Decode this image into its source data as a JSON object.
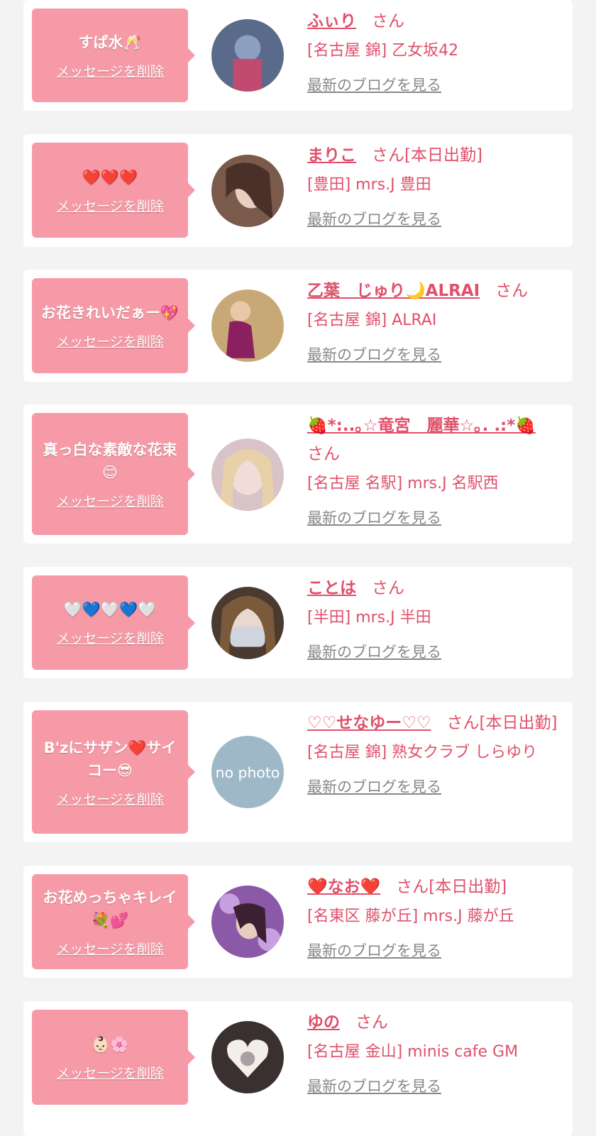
{
  "items": [
    {
      "message": "すぱ水🥂",
      "delete_label": "メッセージを削除",
      "name": "ふぃり",
      "suffix": "さん",
      "shop": "[名古屋 錦] 乙女坂42",
      "blog_label": "最新のブログを見る",
      "avatar_color": "#5a6a8a"
    },
    {
      "message": "❤️❤️❤️",
      "delete_label": "メッセージを削除",
      "name": "まりこ",
      "suffix": "さん[本日出勤]",
      "shop": "[豊田] mrs.J 豊田",
      "blog_label": "最新のブログを見る",
      "avatar_color": "#7a5a4a"
    },
    {
      "message": "お花きれいだぁー💖",
      "delete_label": "メッセージを削除",
      "name": "乙葉　じゅり🌙ALRAI",
      "suffix": "さん",
      "shop": "[名古屋 錦] ALRAI",
      "blog_label": "最新のブログを見る",
      "avatar_color": "#c9a878"
    },
    {
      "message": "真っ白な素敵な花束😊",
      "delete_label": "メッセージを削除",
      "name": "🍓*:..｡☆竜宮　麗華☆｡. .:*🍓",
      "suffix": "さん",
      "shop": "[名古屋 名駅] mrs.J 名駅西",
      "blog_label": "最新のブログを見る",
      "avatar_color": "#d8c4c8"
    },
    {
      "message": "🤍💙🤍💙🤍",
      "delete_label": "メッセージを削除",
      "name": "ことは",
      "suffix": "さん",
      "shop": "[半田] mrs.J 半田",
      "blog_label": "最新のブログを見る",
      "avatar_color": "#4a3a30"
    },
    {
      "message": "B'zにサザン❤️サイコー😎",
      "delete_label": "メッセージを削除",
      "name": "♡♡せなゆー♡♡",
      "suffix": "さん[本日出勤]",
      "shop": "[名古屋 錦] 熟女クラブ しらゆり",
      "blog_label": "最新のブログを見る",
      "avatar_color": "#9fb8c8",
      "avatar_text": "no photo"
    },
    {
      "message": "お花めっちゃキレイ💐💕",
      "delete_label": "メッセージを削除",
      "name": "❤️なお❤️",
      "suffix": "さん[本日出勤]",
      "shop": "[名東区 藤が丘] mrs.J 藤が丘",
      "blog_label": "最新のブログを見る",
      "avatar_color": "#8a5aa8"
    },
    {
      "message": "👶🏻🌸",
      "delete_label": "メッセージを削除",
      "name": "ゆの",
      "suffix": "さん",
      "shop": "[名古屋 金山] minis cafe GM",
      "blog_label": "最新のブログを見る",
      "avatar_color": "#3a3030"
    }
  ]
}
